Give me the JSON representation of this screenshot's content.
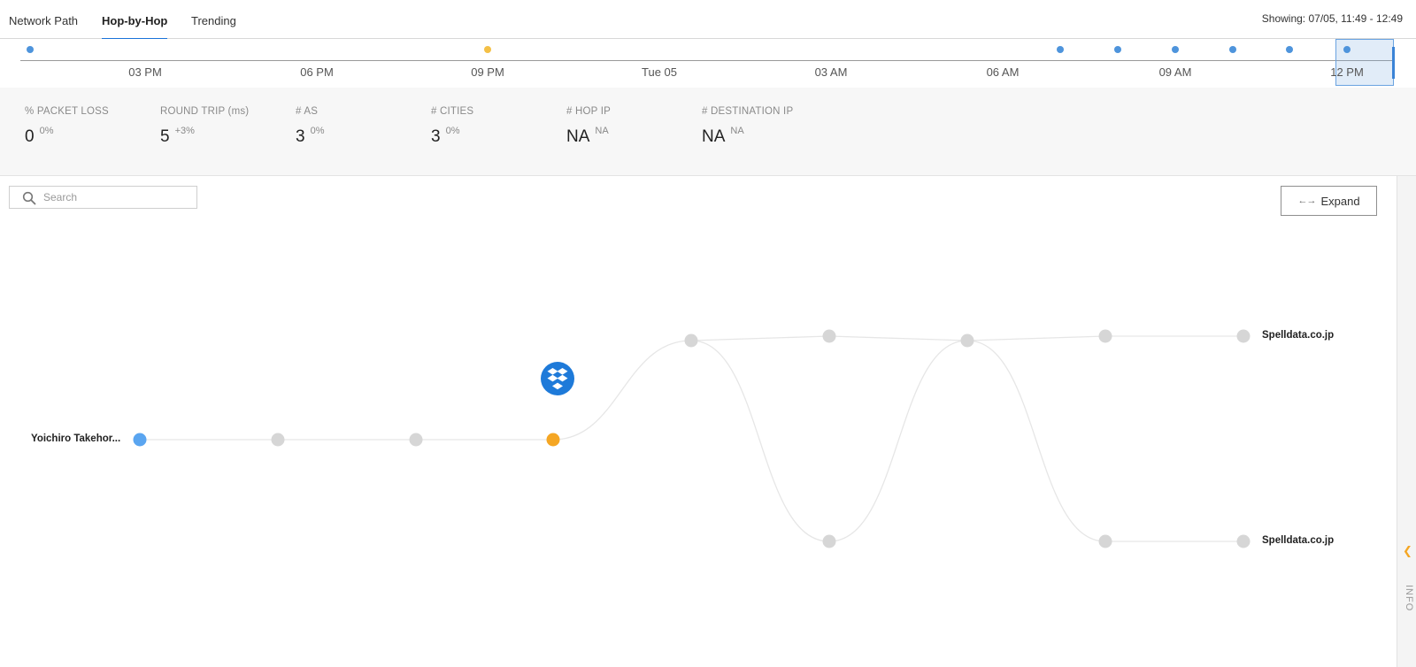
{
  "tabs": [
    {
      "label": "Network Path"
    },
    {
      "label": "Hop-by-Hop"
    },
    {
      "label": "Trending"
    }
  ],
  "showing": "Showing: 07/05, 11:49 - 12:49",
  "timeline": {
    "ticks": [
      "03 PM",
      "06 PM",
      "09 PM",
      "Tue 05",
      "03 AM",
      "06 AM",
      "09 AM",
      "12 PM"
    ]
  },
  "metrics": [
    {
      "label": "% PACKET LOSS",
      "value": "0",
      "delta": "0%"
    },
    {
      "label": "ROUND TRIP (ms)",
      "value": "5",
      "delta": "+3%"
    },
    {
      "label": "# AS",
      "value": "3",
      "delta": "0%"
    },
    {
      "label": "# CITIES",
      "value": "3",
      "delta": "0%"
    },
    {
      "label": "# HOP IP",
      "value": "NA",
      "delta": "NA"
    },
    {
      "label": "# DESTINATION IP",
      "value": "NA",
      "delta": "NA"
    }
  ],
  "search": {
    "placeholder": "Search"
  },
  "expand": {
    "label": "Expand",
    "arrows": "←→"
  },
  "graph": {
    "source_label": "Yoichiro Takehor...",
    "destinations": [
      "Spelldata.co.jp",
      "Spelldata.co.jp"
    ],
    "colors": {
      "source": "#5aa5f0",
      "highlight": "#f5a623",
      "hop": "#d6d6d6",
      "link": "#e6e6e6",
      "badge": "#1e7ad9"
    },
    "badge_icon": "dropbox-icon"
  },
  "info": {
    "label": "INFO",
    "chevron": "❮"
  }
}
